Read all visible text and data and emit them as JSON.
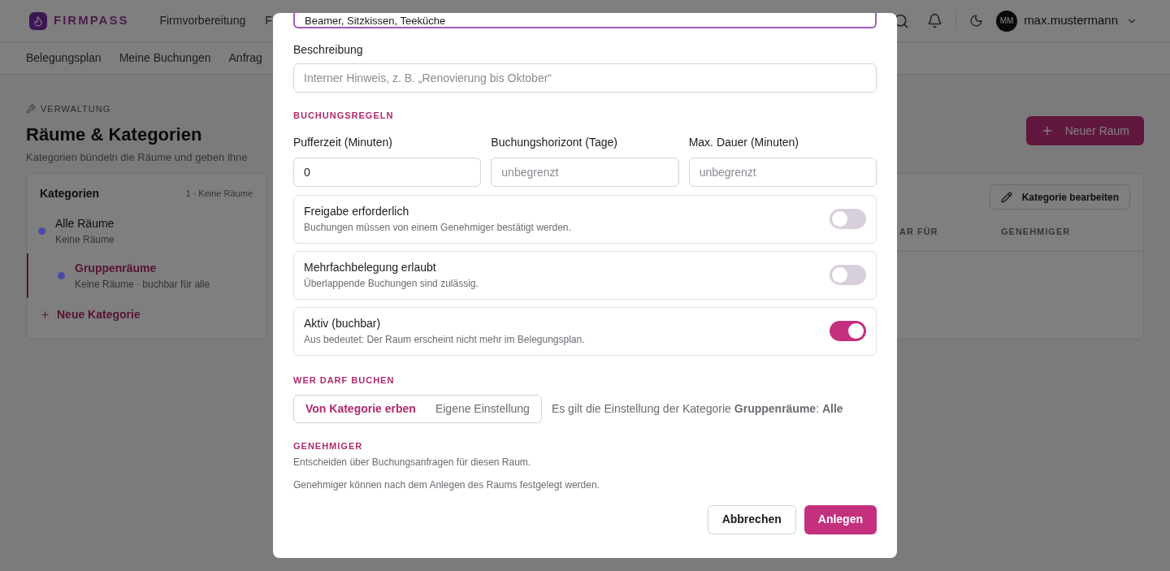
{
  "brand": {
    "name": "FIRMPASS"
  },
  "nav": [
    {
      "label": "Firmvorbereitung"
    },
    {
      "label": "F"
    }
  ],
  "user": {
    "initials": "MM",
    "name": "max.mustermann"
  },
  "subnav": [
    {
      "label": "Belegungsplan"
    },
    {
      "label": "Meine Buchungen"
    },
    {
      "label": "Anfrag"
    }
  ],
  "page": {
    "eyebrow": "VERWALTUNG",
    "title": "Räume & Kategorien",
    "subtitle": "Kategorien bündeln die Räume und geben ihne",
    "new_button": "Neuer Raum"
  },
  "categories": {
    "title": "Kategorien",
    "count": "1 · Keine Räume",
    "add_label": "Neue Kategorie",
    "items": [
      {
        "name": "Alle Räume",
        "meta": "Keine Räume",
        "color": "#4c4aa8",
        "selected": false,
        "children": [
          {
            "name": "Gruppenräume",
            "meta": "Keine Räume · buchbar für alle",
            "color": "#4c4aa8",
            "selected": true
          }
        ]
      }
    ]
  },
  "detail": {
    "edit_button": "Kategorie bearbeiten",
    "columns": [
      "AR FÜR",
      "GENEHMIGER"
    ]
  },
  "dialog": {
    "top_field": {
      "value": "Beamer, Sitzkissen, Teeküche"
    },
    "description": {
      "label": "Beschreibung",
      "placeholder": "Interner Hinweis, z. B. „Renovierung bis Oktober“"
    },
    "rules": {
      "heading": "BUCHUNGSREGELN",
      "fields": [
        {
          "label": "Pufferzeit (Minuten)",
          "value": "0"
        },
        {
          "label": "Buchungshorizont (Tage)",
          "placeholder": "unbegrenzt"
        },
        {
          "label": "Max. Dauer (Minuten)",
          "placeholder": "unbegrenzt"
        }
      ],
      "toggles": [
        {
          "title": "Freigabe erforderlich",
          "hint": "Buchungen müssen von einem Genehmiger bestätigt werden.",
          "on": false
        },
        {
          "title": "Mehrfachbelegung erlaubt",
          "hint": "Überlappende Buchungen sind zulässig.",
          "on": false
        },
        {
          "title": "Aktiv (buchbar)",
          "hint": "Aus bedeutet: Der Raum erscheint nicht mehr im Belegungsplan.",
          "on": true
        }
      ]
    },
    "access": {
      "heading": "WER DARF BUCHEN",
      "options": [
        {
          "label": "Von Kategorie erben",
          "selected": true
        },
        {
          "label": "Eigene Einstellung",
          "selected": false
        }
      ],
      "note": "Es gilt die Einstellung der Kategorie **Gruppenräume**: **Alle**"
    },
    "approvers": {
      "heading": "GENEHMIGER",
      "hint": "Entscheiden über Buchungsanfragen für diesen Raum.",
      "note": "Genehmiger können nach dem Anlegen des Raums festgelegt werden."
    },
    "actions": [
      {
        "label": "Abbrechen",
        "kind": "secondary"
      },
      {
        "label": "Anlegen",
        "kind": "primary"
      }
    ]
  }
}
